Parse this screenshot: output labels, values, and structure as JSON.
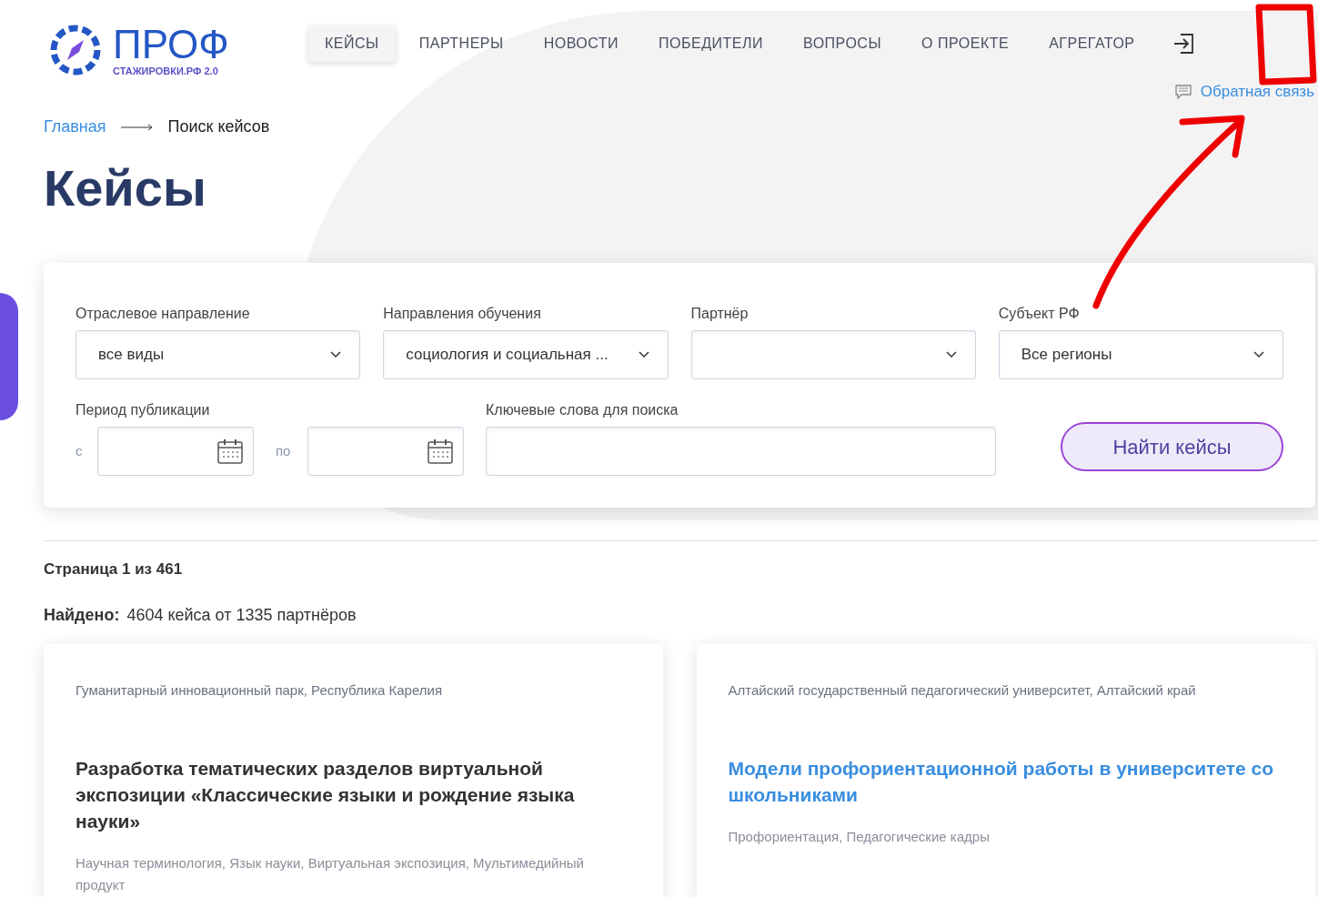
{
  "logo": {
    "title": "ПРОФ",
    "subtitle": "СТАЖИРОВКИ.РФ 2.0"
  },
  "nav": [
    {
      "label": "КЕЙСЫ",
      "selected": true
    },
    {
      "label": "ПАРТНЕРЫ",
      "selected": false
    },
    {
      "label": "НОВОСТИ",
      "selected": false
    },
    {
      "label": "ПОБЕДИТЕЛИ",
      "selected": false
    },
    {
      "label": "ВОПРОСЫ",
      "selected": false
    },
    {
      "label": "О ПРОЕКТЕ",
      "selected": false
    },
    {
      "label": "АГРЕГАТОР",
      "selected": false
    }
  ],
  "feedback_link": "Обратная связь",
  "breadcrumb": [
    "Главная",
    "Поиск кейсов"
  ],
  "title": "Кейсы",
  "filters": {
    "selects": [
      {
        "label": "Отраслевое направление",
        "value": "все виды"
      },
      {
        "label": "Направления обучения",
        "value": "социология и социальная ..."
      },
      {
        "label": "Партнёр"
      },
      {
        "label": "Субъект РФ",
        "value": "Все регионы"
      }
    ],
    "period": {
      "label": "Период публикации",
      "from": "с",
      "to": "по"
    },
    "keywords": {
      "label": "Ключевые слова для поиска"
    },
    "search_button": "Найти кейсы"
  },
  "page_info": "Страница 1 из 461",
  "found": {
    "label": "Найдено:",
    "text": "4604 кейса от 1335 партнёров"
  },
  "cases": [
    {
      "partner": "Гуманитарный инновационный парк, Республика Карелия",
      "title": "Разработка тематических разделов виртуальной экспозиции «Классические языки и рождение языка науки»",
      "highlighted": false,
      "tags": "Научная терминология, Язык науки, Виртуальная экспозиция, Мультимедийный продукт"
    },
    {
      "partner": "Алтайский государственный педагогический университет, Алтайский край",
      "title": "Модели профориентационной работы в университете со школьниками",
      "highlighted": true,
      "tags": "Профориентация, Педагогические кадры"
    }
  ]
}
